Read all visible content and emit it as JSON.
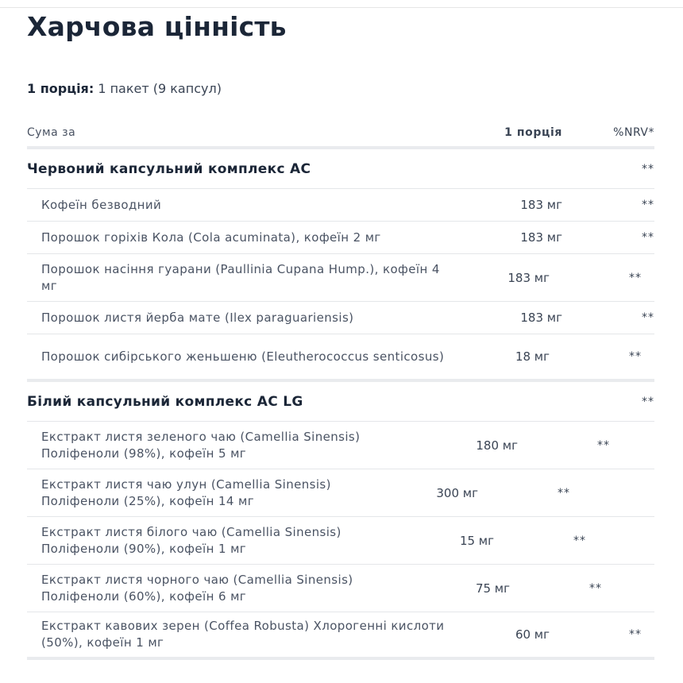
{
  "title": "Харчова цінність",
  "serving": {
    "label": "1 порція:",
    "value": "1 пакет (9 капсул)"
  },
  "header": {
    "name": "Сума за",
    "amount": "1 порція",
    "nrv": "%NRV*"
  },
  "groups": [
    {
      "name": "Червоний капсульний комплекс AC",
      "nrv": "**",
      "items": [
        {
          "name": "Кофеїн безводний",
          "amount": "183 мг",
          "nrv": "**"
        },
        {
          "name": "Порошок горіхів Кола (Cola acuminata), кофеїн 2 мг",
          "amount": "183 мг",
          "nrv": "**"
        },
        {
          "name": "Порошок насіння гуарани (Paullinia Cupana Hump.), кофеїн 4 мг",
          "amount": "183 мг",
          "nrv": "**"
        },
        {
          "name": "Порошок листя йерба мате (Ilex paraguariensis)",
          "amount": "183 мг",
          "nrv": "**"
        },
        {
          "name": "Порошок сибірського женьшеню (Eleutherococcus senticosus)",
          "amount": "18 мг",
          "nrv": "**"
        }
      ]
    },
    {
      "name": "Білий капсульний комплекс AC LG",
      "nrv": "**",
      "items": [
        {
          "name": "Екстракт листя зеленого чаю (Camellia Sinensis) Поліфеноли (98%), кофеїн 5 мг",
          "amount": "180 мг",
          "nrv": "**"
        },
        {
          "name": "Екстракт листя чаю улун (Camellia Sinensis) Поліфеноли (25%), кофеїн 14 мг",
          "amount": "300 мг",
          "nrv": "**"
        },
        {
          "name": "Екстракт листя білого чаю (Camellia Sinensis) Поліфеноли (90%), кофеїн 1 мг",
          "amount": "15 мг",
          "nrv": "**"
        },
        {
          "name": "Екстракт листя чорного чаю (Camellia Sinensis) Поліфеноли (60%), кофеїн 6 мг",
          "amount": "75 мг",
          "nrv": "**"
        },
        {
          "name": "Екстракт кавових зерен (Coffea Robusta) Хлорогенні кислоти (50%), кофеїн 1 мг",
          "amount": "60 мг",
          "nrv": "**"
        }
      ]
    }
  ]
}
